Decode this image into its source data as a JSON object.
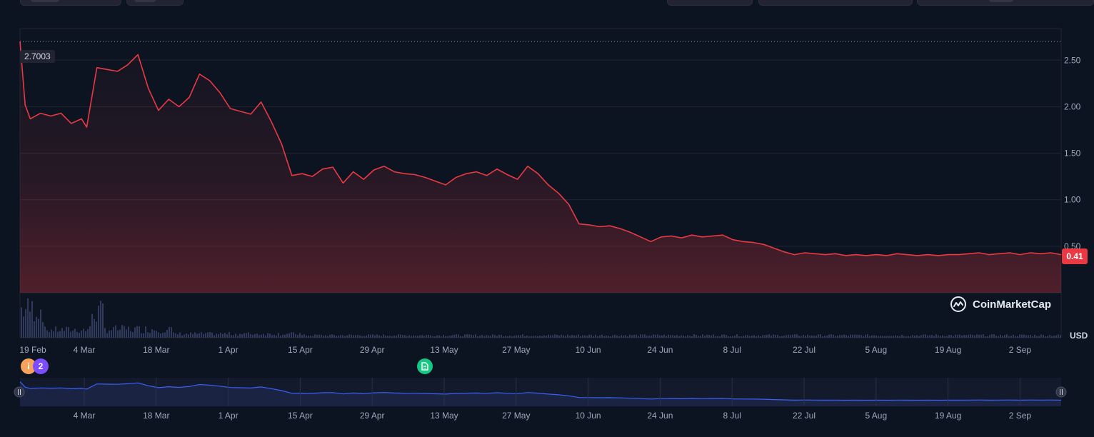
{
  "chart_data": {
    "type": "line",
    "currency": "USD",
    "brand": "CoinMarketCap",
    "high_label": "2.7003",
    "current_price_label": "0.41",
    "y_ticks": [
      "2.50",
      "2.00",
      "1.50",
      "1.00",
      "0.50"
    ],
    "ylim": [
      0.0,
      2.84
    ],
    "x_ticks": [
      "19 Feb",
      "4 Mar",
      "18 Mar",
      "1 Apr",
      "15 Apr",
      "29 Apr",
      "13 May",
      "27 May",
      "10 Jun",
      "24 Jun",
      "8 Jul",
      "22 Jul",
      "5 Aug",
      "19 Aug",
      "2 Sep"
    ],
    "navigator_x_ticks": [
      "4 Mar",
      "18 Mar",
      "1 Apr",
      "15 Apr",
      "29 Apr",
      "13 May",
      "27 May",
      "10 Jun",
      "24 Jun",
      "8 Jul",
      "22 Jul",
      "5 Aug",
      "19 Aug",
      "2 Sep"
    ],
    "series": [
      {
        "x": [
          "2024-02-19",
          "2024-02-20",
          "2024-02-21",
          "2024-02-23",
          "2024-02-25",
          "2024-02-27",
          "2024-02-29",
          "2024-03-02",
          "2024-03-03",
          "2024-03-05",
          "2024-03-07",
          "2024-03-09",
          "2024-03-11",
          "2024-03-13",
          "2024-03-15",
          "2024-03-17",
          "2024-03-19",
          "2024-03-21",
          "2024-03-23",
          "2024-03-25",
          "2024-03-27",
          "2024-03-29",
          "2024-03-31",
          "2024-04-02",
          "2024-04-04",
          "2024-04-06",
          "2024-04-08",
          "2024-04-10",
          "2024-04-12",
          "2024-04-14",
          "2024-04-16",
          "2024-04-18",
          "2024-04-20",
          "2024-04-22",
          "2024-04-24",
          "2024-04-26",
          "2024-04-28",
          "2024-04-30",
          "2024-05-02",
          "2024-05-04",
          "2024-05-06",
          "2024-05-08",
          "2024-05-10",
          "2024-05-12",
          "2024-05-14",
          "2024-05-16",
          "2024-05-18",
          "2024-05-20",
          "2024-05-22",
          "2024-05-24",
          "2024-05-26",
          "2024-05-28",
          "2024-05-30",
          "2024-06-01",
          "2024-06-03",
          "2024-06-05",
          "2024-06-07",
          "2024-06-09",
          "2024-06-11",
          "2024-06-13",
          "2024-06-15",
          "2024-06-17",
          "2024-06-19",
          "2024-06-21",
          "2024-06-23",
          "2024-06-25",
          "2024-06-27",
          "2024-06-29",
          "2024-07-01",
          "2024-07-03",
          "2024-07-05",
          "2024-07-07",
          "2024-07-09",
          "2024-07-11",
          "2024-07-13",
          "2024-07-15",
          "2024-07-17",
          "2024-07-19",
          "2024-07-21",
          "2024-07-23",
          "2024-07-25",
          "2024-07-27",
          "2024-07-29",
          "2024-07-31",
          "2024-08-02",
          "2024-08-04",
          "2024-08-06",
          "2024-08-08",
          "2024-08-10",
          "2024-08-12",
          "2024-08-14",
          "2024-08-16",
          "2024-08-18",
          "2024-08-20",
          "2024-08-22",
          "2024-08-24",
          "2024-08-26",
          "2024-08-28",
          "2024-08-30",
          "2024-09-01",
          "2024-09-03",
          "2024-09-05",
          "2024-09-07",
          "2024-09-09"
        ],
        "values": [
          2.7,
          2.02,
          1.87,
          1.93,
          1.9,
          1.93,
          1.82,
          1.87,
          1.78,
          2.42,
          2.4,
          2.38,
          2.45,
          2.56,
          2.2,
          1.96,
          2.08,
          2.0,
          2.1,
          2.35,
          2.28,
          2.15,
          1.98,
          1.95,
          1.92,
          2.05,
          1.84,
          1.6,
          1.26,
          1.28,
          1.25,
          1.33,
          1.35,
          1.18,
          1.3,
          1.22,
          1.32,
          1.36,
          1.3,
          1.28,
          1.27,
          1.24,
          1.2,
          1.16,
          1.24,
          1.28,
          1.3,
          1.26,
          1.33,
          1.27,
          1.22,
          1.36,
          1.28,
          1.16,
          1.07,
          0.95,
          0.74,
          0.73,
          0.71,
          0.72,
          0.69,
          0.65,
          0.6,
          0.55,
          0.6,
          0.61,
          0.59,
          0.62,
          0.6,
          0.61,
          0.62,
          0.57,
          0.55,
          0.54,
          0.52,
          0.48,
          0.44,
          0.41,
          0.43,
          0.42,
          0.41,
          0.42,
          0.4,
          0.41,
          0.4,
          0.41,
          0.4,
          0.42,
          0.41,
          0.4,
          0.41,
          0.4,
          0.41,
          0.41,
          0.42,
          0.43,
          0.41,
          0.42,
          0.43,
          0.41,
          0.43,
          0.42,
          0.43,
          0.41
        ]
      }
    ],
    "grid": true,
    "events": [
      {
        "label": "i",
        "color": "#f7a35c"
      },
      {
        "label": "2",
        "color": "#7c4dff"
      },
      {
        "label": "doc",
        "color": "#16c784"
      }
    ],
    "colors": {
      "line": "#ea3943",
      "volume": "#2f3a5c",
      "navigator_line": "#3861fb",
      "navigator_fill": "#1b2342",
      "price_tag": "#ea3943"
    }
  }
}
